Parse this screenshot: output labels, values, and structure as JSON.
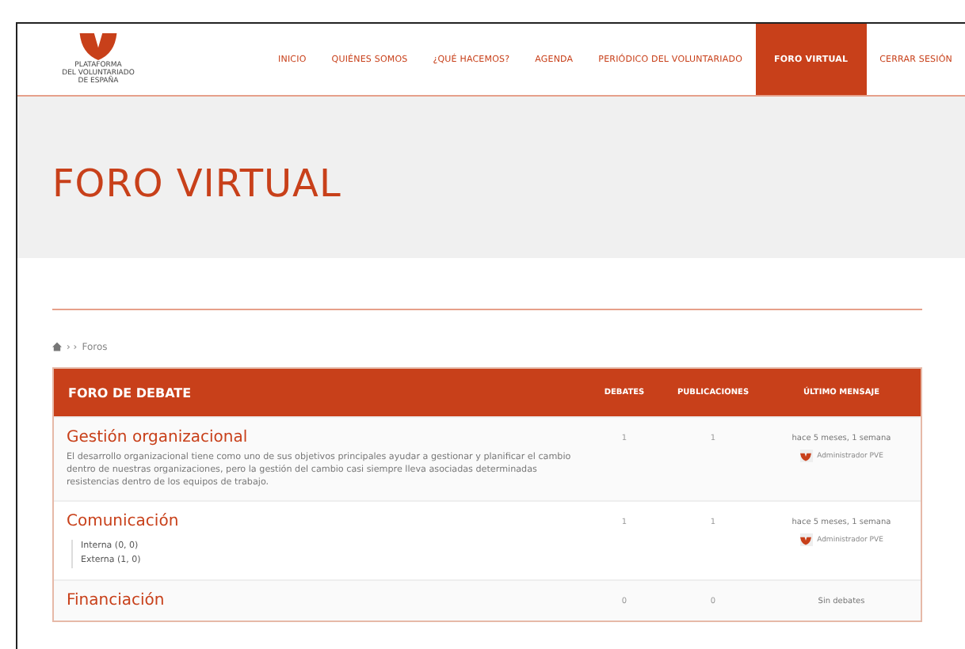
{
  "logo": {
    "lines": [
      "PLATAFORMA",
      "DEL VOLUNTARIADO",
      "DE ESPAÑA"
    ]
  },
  "nav": [
    {
      "label": "INICIO",
      "selected": false
    },
    {
      "label": "QUIÉNES SOMOS",
      "selected": false
    },
    {
      "label": "¿QUÉ HACEMOS?",
      "selected": false
    },
    {
      "label": "AGENDA",
      "selected": false
    },
    {
      "label": "PERIÓDICO DEL VOLUNTARIADO",
      "selected": false
    },
    {
      "label": "FORO VIRTUAL",
      "selected": true
    },
    {
      "label": "CERRAR SESIÓN",
      "selected": false
    }
  ],
  "page_title": "FORO VIRTUAL",
  "breadcrumb": {
    "separators": "› ›",
    "current": "Foros"
  },
  "table": {
    "columns": [
      "FORO DE DEBATE",
      "DEBATES",
      "PUBLICACIONES",
      "ÚLTIMO MENSAJE"
    ],
    "rows": [
      {
        "title": "Gestión organizacional",
        "description": "El desarrollo organizacional tiene como uno de sus objetivos principales ayudar a gestionar y planificar el cambio dentro de nuestras organizaciones, pero la gestión del cambio casi siempre lleva asociadas determinadas resistencias dentro de los equipos de trabajo.",
        "debates": "1",
        "posts": "1",
        "last_time": "hace 5 meses, 1 semana",
        "last_author": "Administrador PVE"
      },
      {
        "title": "Comunicación",
        "subforums": [
          "Interna (0, 0)",
          "Externa (1, 0)"
        ],
        "debates": "1",
        "posts": "1",
        "last_time": "hace 5 meses, 1 semana",
        "last_author": "Administrador PVE"
      },
      {
        "title": "Financiación",
        "debates": "0",
        "posts": "0",
        "last_none": "Sin debates"
      }
    ]
  }
}
